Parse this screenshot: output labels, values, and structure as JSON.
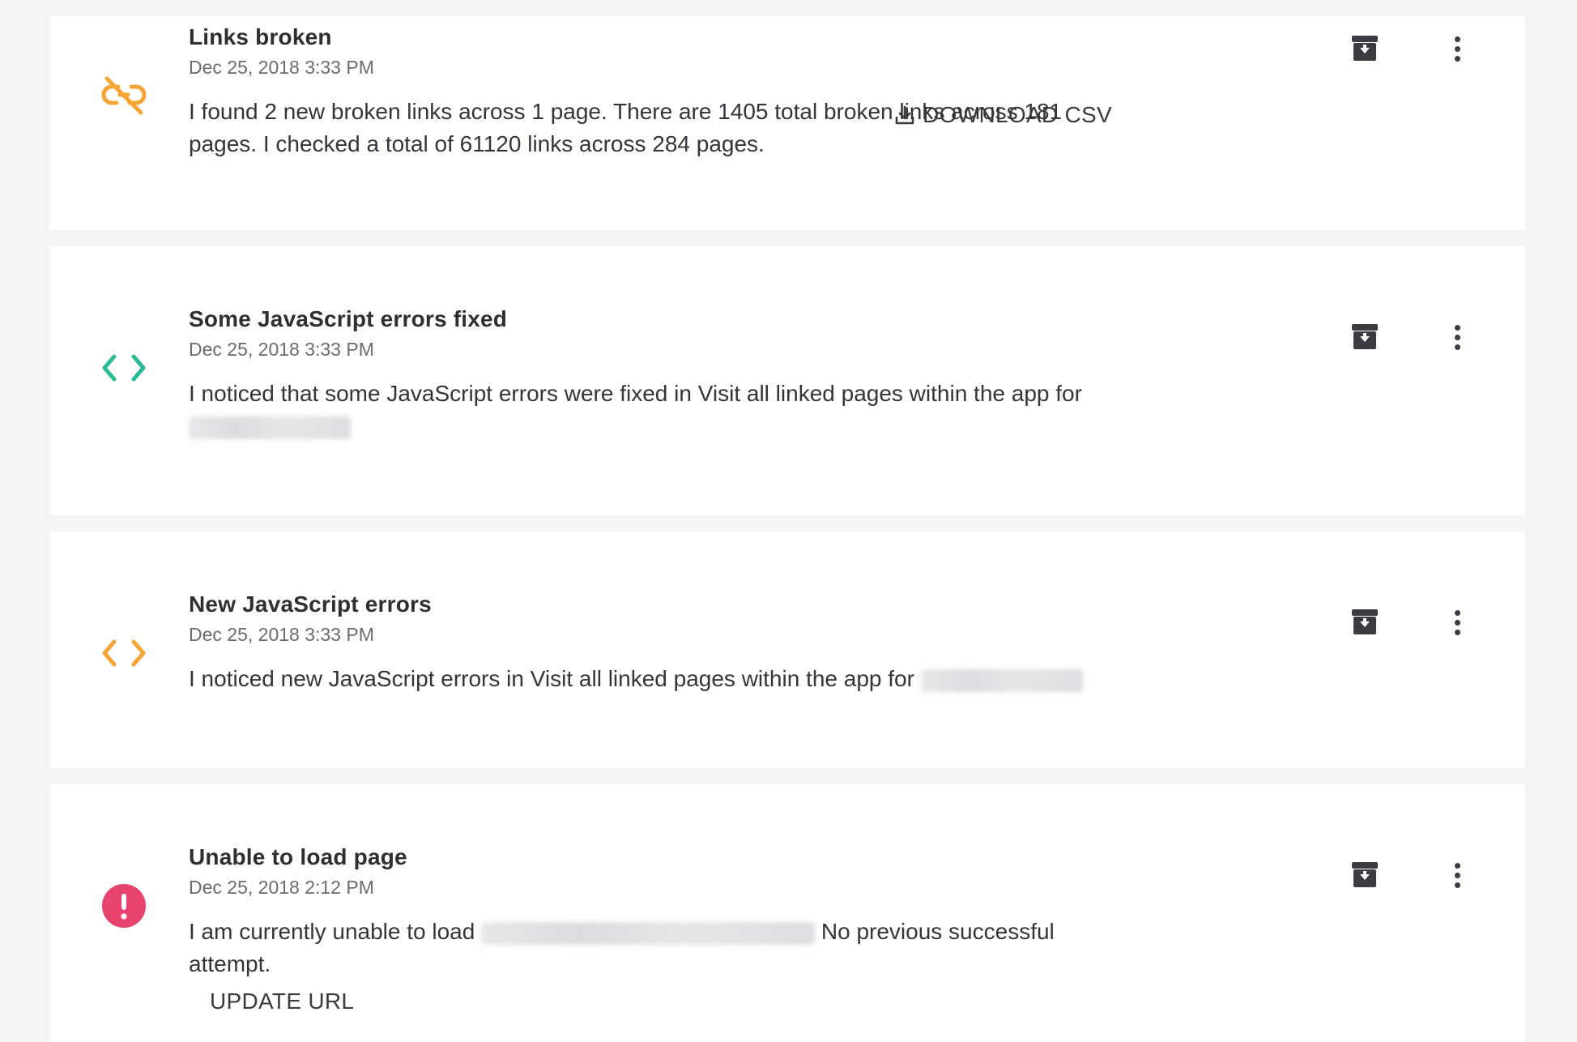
{
  "colors": {
    "warning": "#f5a535",
    "success": "#2dbb97",
    "error": "#e8426e",
    "icon_dark": "#3b3b42"
  },
  "notifications": [
    {
      "icon": "broken-link-icon",
      "title": "Links broken",
      "date": "Dec 25, 2018 3:33 PM",
      "text": "I found 2 new broken links across 1 page. There are 1405 total broken links across 181 pages. I checked a total of 61120 links across 284 pages.",
      "action_label": "DOWNLOAD CSV"
    },
    {
      "icon": "code-icon",
      "title": "Some JavaScript errors fixed",
      "date": "Dec 25, 2018 3:33 PM",
      "text": "I noticed that some JavaScript errors were fixed in Visit all linked pages within the app for"
    },
    {
      "icon": "code-icon",
      "title": "New JavaScript errors",
      "date": "Dec 25, 2018 3:33 PM",
      "text": "I noticed new JavaScript errors in Visit all linked pages within the app for"
    },
    {
      "icon": "alert-icon",
      "title": "Unable to load page",
      "date": "Dec 25, 2018 2:12 PM",
      "text_before": "I am currently unable to load",
      "text_after": "No previous successful attempt.",
      "action_label": "UPDATE URL"
    }
  ]
}
